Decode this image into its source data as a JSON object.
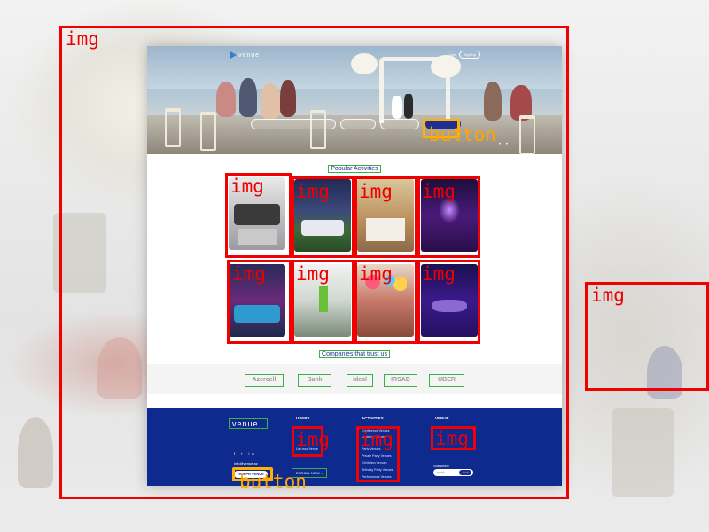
{
  "hero": {
    "brand": "venue",
    "login": "Login",
    "signup": "Sign Up",
    "search_fields": [
      "",
      "",
      ""
    ],
    "search_button": "",
    "slider_dots": "• •"
  },
  "sections": {
    "popular": "Popular Activities",
    "companies": "Companies that trust us"
  },
  "partners": [
    "Azercell",
    "Bank",
    "ideal",
    "IRSAD",
    "UBER"
  ],
  "footer": {
    "brand": "venue",
    "columns": [
      {
        "title": "USERS",
        "links": [
          "List your Venue"
        ]
      },
      {
        "title": "ACTIVITIES",
        "links": [
          "Conference Venues",
          "Wedding Venues",
          "Party Venues",
          "Private Party Venues",
          "Exhibition Venues",
          "Birthday Party Venues",
          "Performance Venues"
        ]
      },
      {
        "title": "VENUE",
        "links": []
      }
    ],
    "social": "f  t  in",
    "email": "info@venue.az",
    "phone": "*935 PR VENUE",
    "cta": "ENROLL NOW »",
    "subscribe_label": "Subscribe",
    "subscribe_placeholder": "email",
    "subscribe_button": "send"
  },
  "annotations": {
    "img_label": "img",
    "button_label": "button"
  },
  "colors": {
    "img_box": "#f00000",
    "button_box": "#ffb000",
    "footer_bg": "#0e2a8f",
    "accent": "#1e2f8f"
  }
}
